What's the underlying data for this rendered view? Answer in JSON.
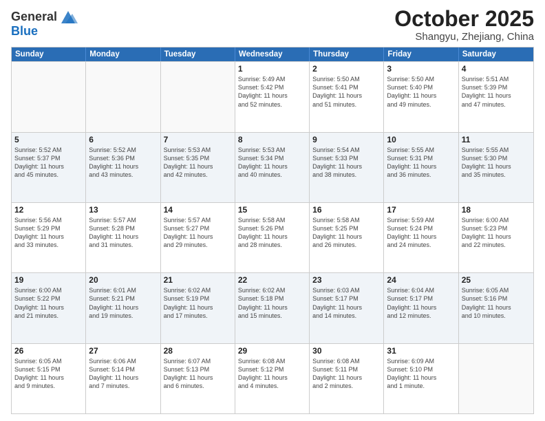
{
  "logo": {
    "line1": "General",
    "line2": "Blue",
    "icon_color": "#1a6fbf"
  },
  "title": "October 2025",
  "subtitle": "Shangyu, Zhejiang, China",
  "header_days": [
    "Sunday",
    "Monday",
    "Tuesday",
    "Wednesday",
    "Thursday",
    "Friday",
    "Saturday"
  ],
  "rows": [
    {
      "alt": false,
      "cells": [
        {
          "day": "",
          "info": ""
        },
        {
          "day": "",
          "info": ""
        },
        {
          "day": "",
          "info": ""
        },
        {
          "day": "1",
          "info": "Sunrise: 5:49 AM\nSunset: 5:42 PM\nDaylight: 11 hours\nand 52 minutes."
        },
        {
          "day": "2",
          "info": "Sunrise: 5:50 AM\nSunset: 5:41 PM\nDaylight: 11 hours\nand 51 minutes."
        },
        {
          "day": "3",
          "info": "Sunrise: 5:50 AM\nSunset: 5:40 PM\nDaylight: 11 hours\nand 49 minutes."
        },
        {
          "day": "4",
          "info": "Sunrise: 5:51 AM\nSunset: 5:39 PM\nDaylight: 11 hours\nand 47 minutes."
        }
      ]
    },
    {
      "alt": true,
      "cells": [
        {
          "day": "5",
          "info": "Sunrise: 5:52 AM\nSunset: 5:37 PM\nDaylight: 11 hours\nand 45 minutes."
        },
        {
          "day": "6",
          "info": "Sunrise: 5:52 AM\nSunset: 5:36 PM\nDaylight: 11 hours\nand 43 minutes."
        },
        {
          "day": "7",
          "info": "Sunrise: 5:53 AM\nSunset: 5:35 PM\nDaylight: 11 hours\nand 42 minutes."
        },
        {
          "day": "8",
          "info": "Sunrise: 5:53 AM\nSunset: 5:34 PM\nDaylight: 11 hours\nand 40 minutes."
        },
        {
          "day": "9",
          "info": "Sunrise: 5:54 AM\nSunset: 5:33 PM\nDaylight: 11 hours\nand 38 minutes."
        },
        {
          "day": "10",
          "info": "Sunrise: 5:55 AM\nSunset: 5:31 PM\nDaylight: 11 hours\nand 36 minutes."
        },
        {
          "day": "11",
          "info": "Sunrise: 5:55 AM\nSunset: 5:30 PM\nDaylight: 11 hours\nand 35 minutes."
        }
      ]
    },
    {
      "alt": false,
      "cells": [
        {
          "day": "12",
          "info": "Sunrise: 5:56 AM\nSunset: 5:29 PM\nDaylight: 11 hours\nand 33 minutes."
        },
        {
          "day": "13",
          "info": "Sunrise: 5:57 AM\nSunset: 5:28 PM\nDaylight: 11 hours\nand 31 minutes."
        },
        {
          "day": "14",
          "info": "Sunrise: 5:57 AM\nSunset: 5:27 PM\nDaylight: 11 hours\nand 29 minutes."
        },
        {
          "day": "15",
          "info": "Sunrise: 5:58 AM\nSunset: 5:26 PM\nDaylight: 11 hours\nand 28 minutes."
        },
        {
          "day": "16",
          "info": "Sunrise: 5:58 AM\nSunset: 5:25 PM\nDaylight: 11 hours\nand 26 minutes."
        },
        {
          "day": "17",
          "info": "Sunrise: 5:59 AM\nSunset: 5:24 PM\nDaylight: 11 hours\nand 24 minutes."
        },
        {
          "day": "18",
          "info": "Sunrise: 6:00 AM\nSunset: 5:23 PM\nDaylight: 11 hours\nand 22 minutes."
        }
      ]
    },
    {
      "alt": true,
      "cells": [
        {
          "day": "19",
          "info": "Sunrise: 6:00 AM\nSunset: 5:22 PM\nDaylight: 11 hours\nand 21 minutes."
        },
        {
          "day": "20",
          "info": "Sunrise: 6:01 AM\nSunset: 5:21 PM\nDaylight: 11 hours\nand 19 minutes."
        },
        {
          "day": "21",
          "info": "Sunrise: 6:02 AM\nSunset: 5:19 PM\nDaylight: 11 hours\nand 17 minutes."
        },
        {
          "day": "22",
          "info": "Sunrise: 6:02 AM\nSunset: 5:18 PM\nDaylight: 11 hours\nand 15 minutes."
        },
        {
          "day": "23",
          "info": "Sunrise: 6:03 AM\nSunset: 5:17 PM\nDaylight: 11 hours\nand 14 minutes."
        },
        {
          "day": "24",
          "info": "Sunrise: 6:04 AM\nSunset: 5:17 PM\nDaylight: 11 hours\nand 12 minutes."
        },
        {
          "day": "25",
          "info": "Sunrise: 6:05 AM\nSunset: 5:16 PM\nDaylight: 11 hours\nand 10 minutes."
        }
      ]
    },
    {
      "alt": false,
      "cells": [
        {
          "day": "26",
          "info": "Sunrise: 6:05 AM\nSunset: 5:15 PM\nDaylight: 11 hours\nand 9 minutes."
        },
        {
          "day": "27",
          "info": "Sunrise: 6:06 AM\nSunset: 5:14 PM\nDaylight: 11 hours\nand 7 minutes."
        },
        {
          "day": "28",
          "info": "Sunrise: 6:07 AM\nSunset: 5:13 PM\nDaylight: 11 hours\nand 6 minutes."
        },
        {
          "day": "29",
          "info": "Sunrise: 6:08 AM\nSunset: 5:12 PM\nDaylight: 11 hours\nand 4 minutes."
        },
        {
          "day": "30",
          "info": "Sunrise: 6:08 AM\nSunset: 5:11 PM\nDaylight: 11 hours\nand 2 minutes."
        },
        {
          "day": "31",
          "info": "Sunrise: 6:09 AM\nSunset: 5:10 PM\nDaylight: 11 hours\nand 1 minute."
        },
        {
          "day": "",
          "info": ""
        }
      ]
    }
  ]
}
